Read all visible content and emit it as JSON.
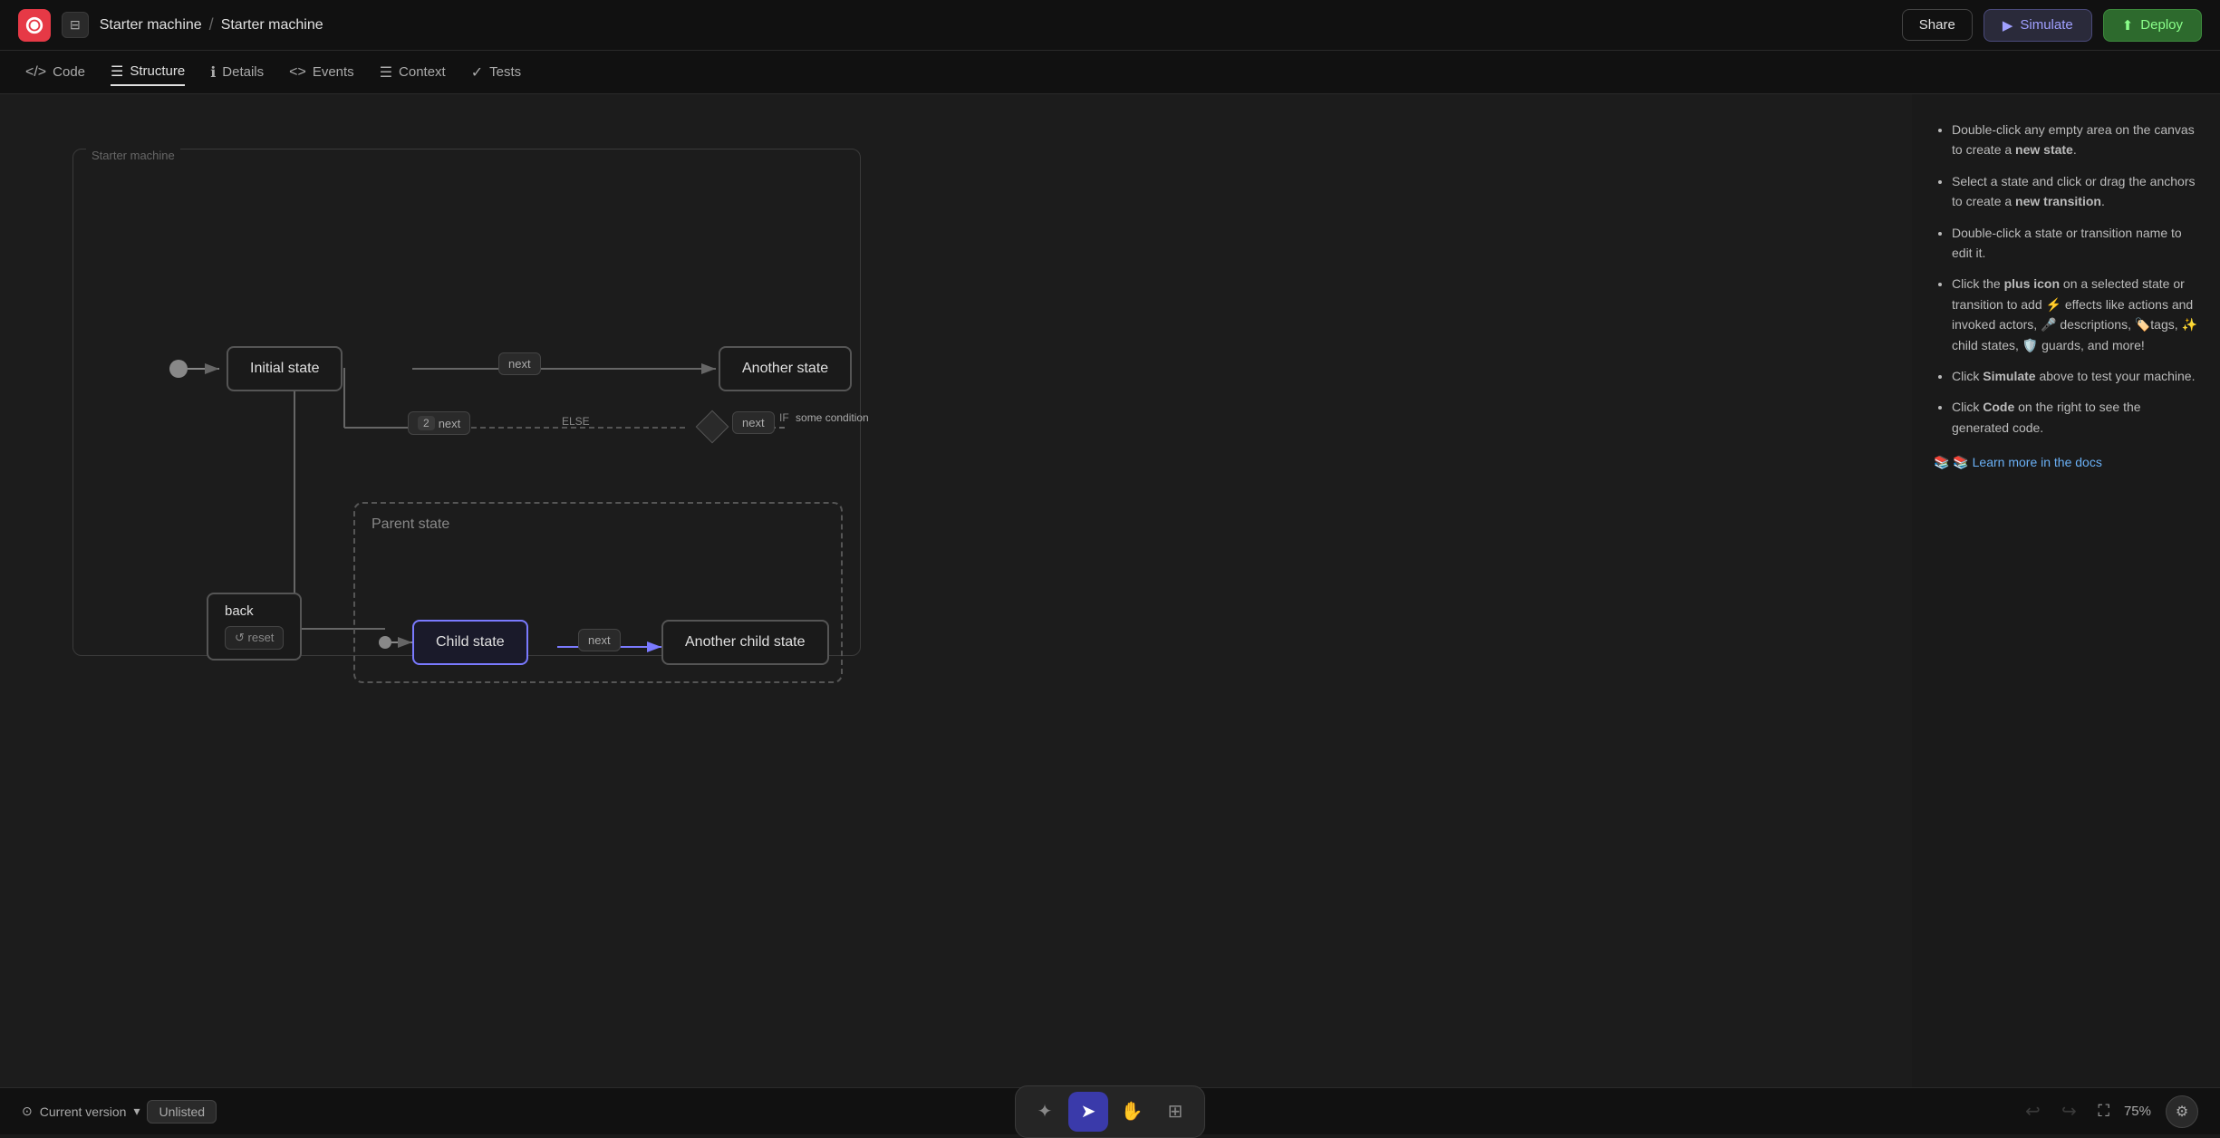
{
  "topbar": {
    "logo_label": "XState",
    "layout_toggle": "⊟",
    "breadcrumb_part1": "Starter machine",
    "breadcrumb_sep": "/",
    "breadcrumb_part2": "Starter machine",
    "share_label": "Share",
    "simulate_label": "Simulate",
    "deploy_label": "Deploy"
  },
  "toolbar": {
    "code_label": "Code",
    "structure_label": "Structure",
    "details_label": "Details",
    "events_label": "Events",
    "context_label": "Context",
    "tests_label": "Tests"
  },
  "canvas": {
    "machine_label": "Starter machine",
    "states": {
      "initial_state": "Initial state",
      "another_state": "Another state",
      "parent_state": "Parent state",
      "child_state": "Child state",
      "another_child_state": "Another child state",
      "back_label": "back",
      "reset_label": "↺ reset"
    },
    "transitions": {
      "next1": "next",
      "next2_label": "2",
      "next2_text": "next",
      "else_text": "ELSE",
      "next3_label": "◆",
      "next3_text": "next",
      "if_text": "IF",
      "condition_text": "some condition",
      "next4": "next"
    }
  },
  "hints": {
    "items": [
      "Double-click any empty area on the canvas to create a new state.",
      "Select a state and click or drag the anchors to create a new transition.",
      "Double-click a state or transition name to edit it.",
      "Click the plus icon on a selected state or transition to add ⚡ effects like actions and invoked actors, 🎤 descriptions, 🏷️ tags, ✨ child states, 🛡️ guards, and more!",
      "Click Simulate above to test your machine.",
      "Click Code on the right to see the generated code."
    ],
    "bold_words": [
      "new state",
      "new transition",
      "plus icon",
      "Simulate",
      "Code"
    ],
    "link_text": "📚 Learn more in the docs",
    "link_url": "#"
  },
  "bottom": {
    "current_version_label": "Current version",
    "chevron_down": "▾",
    "version_badge": "Unlisted",
    "tools": [
      {
        "id": "sparkle",
        "icon": "✦",
        "active": false
      },
      {
        "id": "pointer",
        "icon": "➤",
        "active": true
      },
      {
        "id": "hand",
        "icon": "✋",
        "active": false
      },
      {
        "id": "plus",
        "icon": "⊞",
        "active": false
      }
    ],
    "undo_icon": "↩",
    "redo_icon": "↪",
    "zoom_pct": "75%",
    "fullscreen_icon": "⛶",
    "settings_icon": "⚙"
  }
}
